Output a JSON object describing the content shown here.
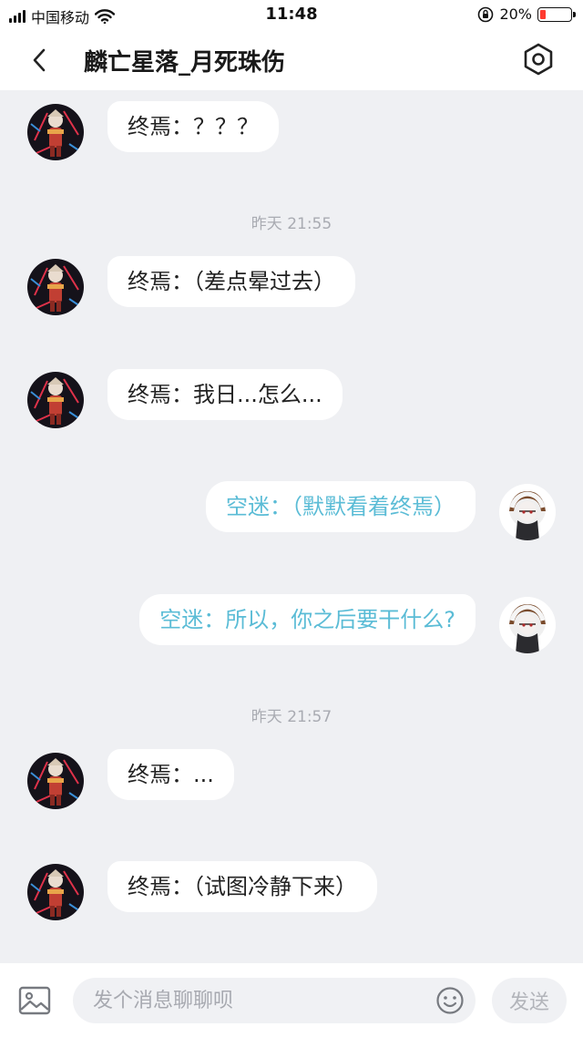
{
  "status_bar": {
    "carrier": "中国移动",
    "time": "11:48",
    "battery_percent": "20%",
    "battery_level": 0.2,
    "icons": [
      "signal-icon",
      "wifi-icon",
      "orientation-lock-icon",
      "battery-icon"
    ]
  },
  "header": {
    "title": "麟亡星落_月死珠伤",
    "back_icon": "chevron-left-icon",
    "settings_icon": "hexagon-settings-icon"
  },
  "messages": [
    {
      "side": "left",
      "text": "终焉：？？？"
    },
    {
      "timestamp": "昨天 21:55"
    },
    {
      "side": "left",
      "text": "终焉：（差点晕过去）"
    },
    {
      "side": "left",
      "text": "终焉：我日...怎么..."
    },
    {
      "side": "right",
      "text": "空迷：（默默看着终焉）"
    },
    {
      "side": "right",
      "text": "空迷：所以，你之后要干什么?"
    },
    {
      "timestamp": "昨天 21:57"
    },
    {
      "side": "left",
      "text": "终焉：..."
    },
    {
      "side": "left",
      "text": "终焉：（试图冷静下来）"
    }
  ],
  "composer": {
    "placeholder": "发个消息聊聊呗",
    "value": "",
    "send_label": "发送",
    "image_icon": "image-icon",
    "emoji_icon": "emoji-icon"
  },
  "colors": {
    "background": "#eff0f3",
    "bubble": "#ffffff",
    "own_text": "#5bbcd6",
    "timestamp": "#a9abb2",
    "battery_low": "#ff3b30"
  }
}
